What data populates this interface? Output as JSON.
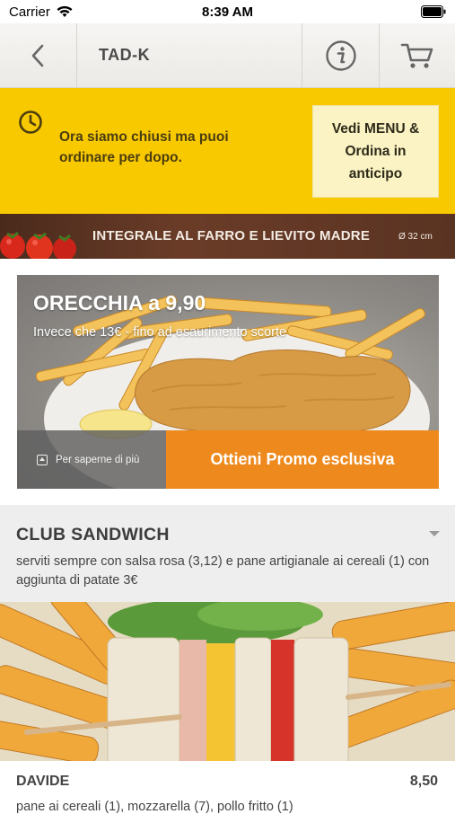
{
  "status_bar": {
    "carrier": "Carrier",
    "time": "8:39 AM"
  },
  "navbar": {
    "title": "TAD-K",
    "back_icon": "chevron-left-icon",
    "info_icon": "info-icon",
    "cart_icon": "cart-icon"
  },
  "closed_banner": {
    "message": "Ora siamo chiusi ma puoi ordinare per dopo.",
    "button_label": "Vedi MENU & Ordina in anticipo",
    "color": "#f9c900"
  },
  "promo_strip": {
    "text": "INTEGRALE AL FARRO E LIEVITO MADRE",
    "size": "Ø 32 cm"
  },
  "offer": {
    "title": "ORECCHIA a 9,90",
    "subtitle": "Invece che 13€ - fino ad esaurimento scorte",
    "more_label": "Per saperne di più",
    "cta_label": "Ottieni Promo esclusiva",
    "cta_color": "#ee8a1d"
  },
  "category": {
    "title": "CLUB SANDWICH",
    "description": "serviti sempre con salsa rosa (3,12) e pane artigianale ai cereali (1) con aggiunta di patate 3€"
  },
  "items": [
    {
      "name": "DAVIDE",
      "price": "8,50",
      "description": "pane ai cereali (1), mozzarella (7), pollo fritto (1)"
    }
  ]
}
